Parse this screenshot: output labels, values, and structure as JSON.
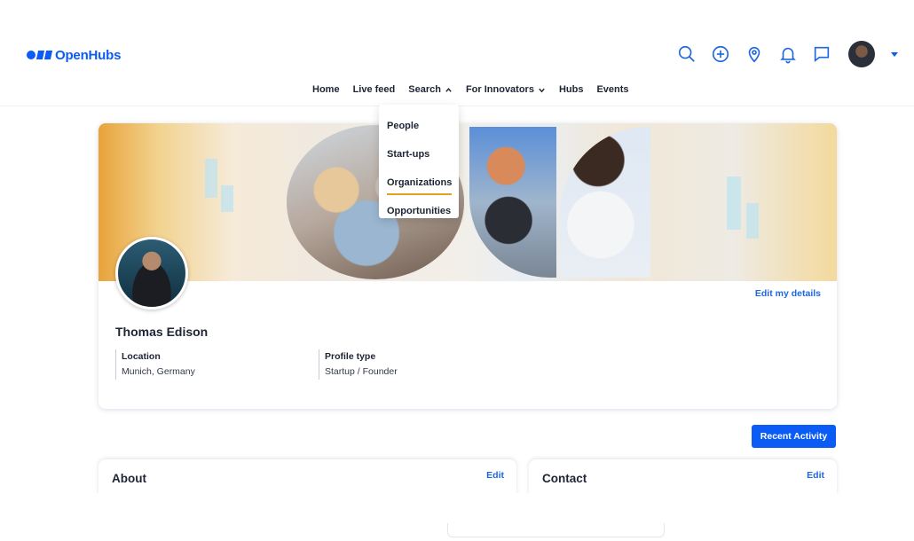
{
  "app": {
    "logo_text": "OpenHubs",
    "brand_color": "#0a5cf5",
    "accent_underline": "#e4a11b"
  },
  "header": {
    "icons": [
      "search-icon",
      "add-circle-icon",
      "location-pin-icon",
      "bell-icon",
      "chat-icon"
    ]
  },
  "nav": {
    "items": [
      {
        "label": "Home"
      },
      {
        "label": "Live feed"
      },
      {
        "label": "Search"
      },
      {
        "label": "For Innovators"
      },
      {
        "label": "Hubs"
      },
      {
        "label": "Events"
      }
    ]
  },
  "dropdown": {
    "items": [
      {
        "label": "People"
      },
      {
        "label": "Start-ups"
      },
      {
        "label": "Organizations"
      },
      {
        "label": "Opportunities"
      }
    ],
    "active": "Organizations"
  },
  "profile": {
    "edit_label": "Edit my details",
    "name": "Thomas Edison",
    "location_label": "Location",
    "location_value": "Munich, Germany",
    "type_label": "Profile type",
    "type_value": "Startup / Founder"
  },
  "actions": {
    "recent_activity": "Recent Activity"
  },
  "sections": {
    "about_title": "About",
    "about_edit": "Edit",
    "contact_title": "Contact",
    "contact_edit": "Edit"
  }
}
